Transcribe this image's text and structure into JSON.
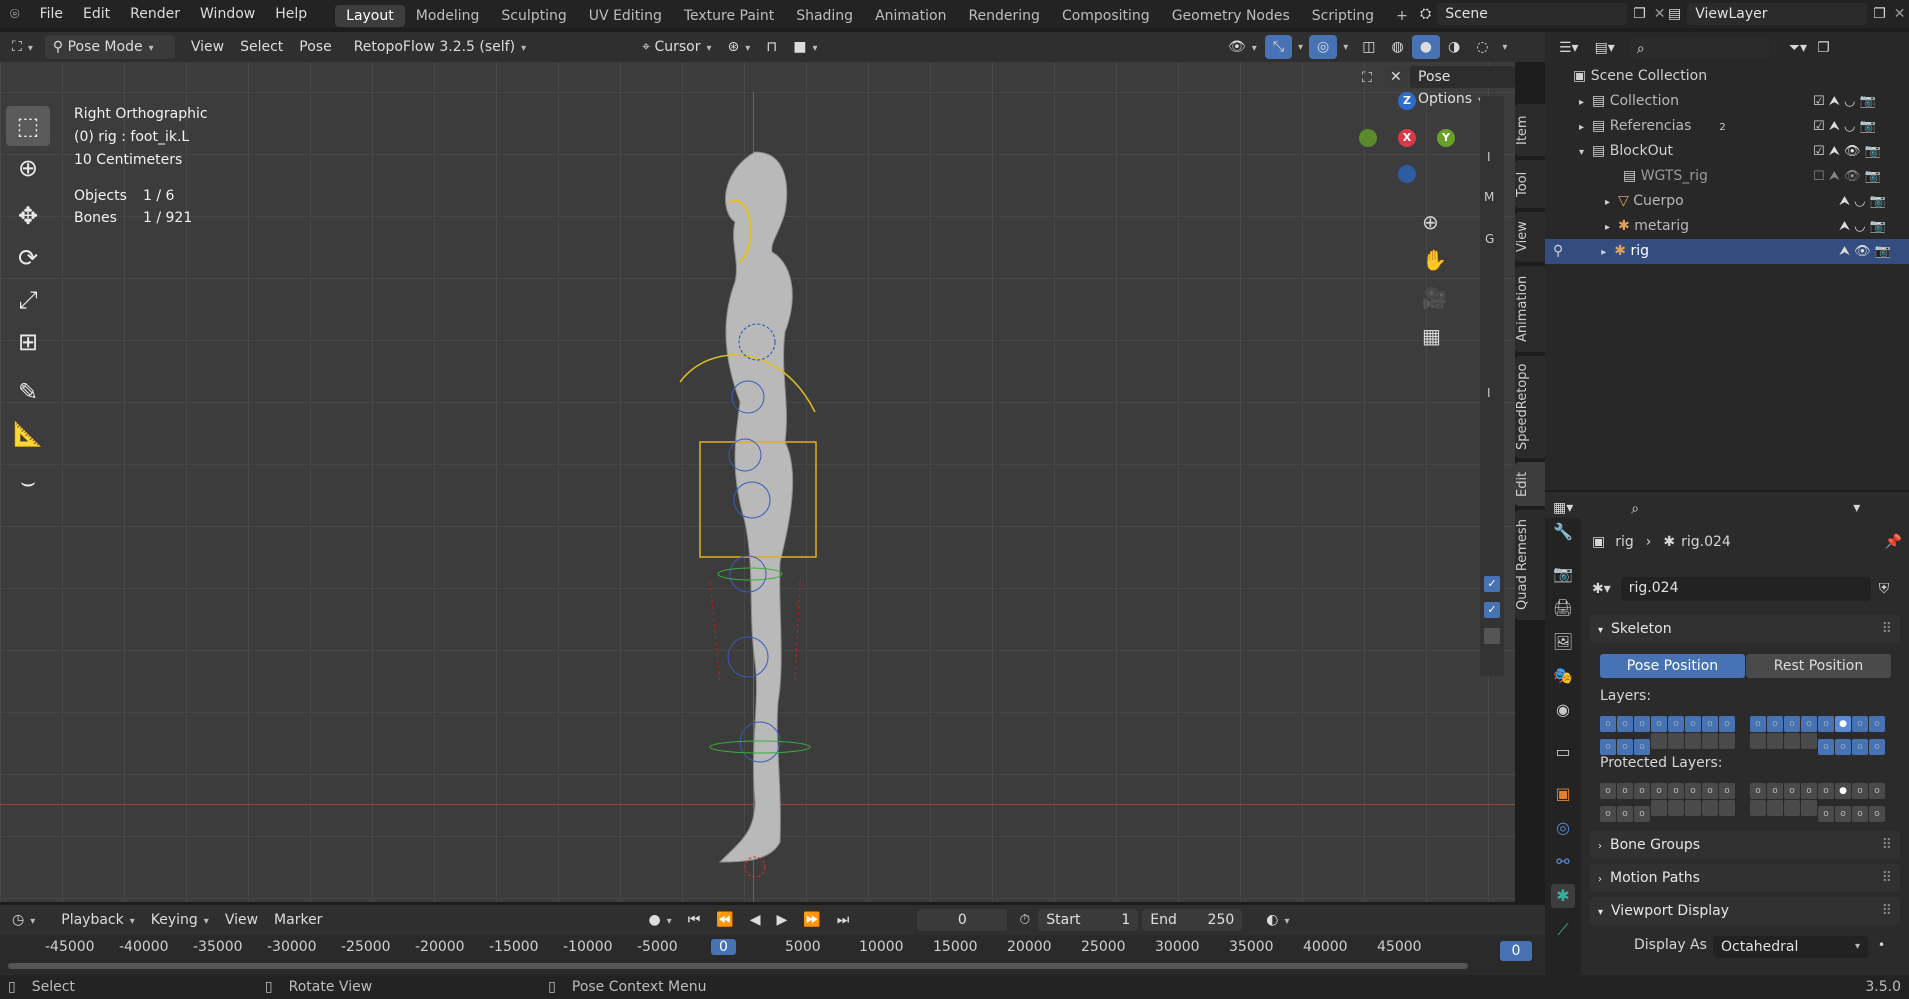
{
  "menu": {
    "items": [
      "File",
      "Edit",
      "Render",
      "Window",
      "Help"
    ]
  },
  "workspaces": {
    "tabs": [
      "Layout",
      "Modeling",
      "Sculpting",
      "UV Editing",
      "Texture Paint",
      "Shading",
      "Animation",
      "Rendering",
      "Compositing",
      "Geometry Nodes",
      "Scripting"
    ],
    "active": "Layout",
    "add": "+"
  },
  "scene": {
    "name": "Scene",
    "view_layer": "ViewLayer"
  },
  "header": {
    "mode": "Pose Mode",
    "view": "View",
    "select": "Select",
    "pose": "Pose",
    "addon": "RetopoFlow 3.2.5 (self)",
    "pivot": "Cursor",
    "pose_options": "Pose Options"
  },
  "viewport": {
    "view_name": "Right Orthographic",
    "object": "(0) rig : foot_ik.L",
    "scale": "10 Centimeters",
    "objects_label": "Objects",
    "objects_value": "1 / 6",
    "bones_label": "Bones",
    "bones_value": "1 / 921",
    "gizmo": {
      "z": "Z",
      "y": "Y",
      "x": "X"
    },
    "strip_letters": [
      "I",
      "M",
      "G",
      "I"
    ]
  },
  "sidetabs": [
    "Item",
    "Tool",
    "View",
    "Animation",
    "SpeedRetopo",
    "Edit",
    "Quad Remesh"
  ],
  "outliner": {
    "root": "Scene Collection",
    "rows": [
      {
        "label": "Collection",
        "indent": 1
      },
      {
        "label": "Referencias",
        "indent": 1,
        "badge": "2"
      },
      {
        "label": "BlockOut",
        "indent": 1
      },
      {
        "label": "WGTS_rig",
        "indent": 2
      },
      {
        "label": "Cuerpo",
        "indent": 2
      },
      {
        "label": "metarig",
        "indent": 2
      },
      {
        "label": "rig",
        "indent": 2
      }
    ]
  },
  "properties": {
    "breadcrumb_obj": "rig",
    "breadcrumb_data": "rig.024",
    "data_name": "rig.024",
    "skeleton": "Skeleton",
    "pose_position": "Pose Position",
    "rest_position": "Rest Position",
    "layers": "Layers:",
    "protected_layers": "Protected Layers:",
    "bone_groups": "Bone Groups",
    "motion_paths": "Motion Paths",
    "viewport_display": "Viewport Display",
    "display_as_label": "Display As",
    "display_as_value": "Octahedral"
  },
  "timeline": {
    "playback": "Playback",
    "keying": "Keying",
    "view": "View",
    "marker": "Marker",
    "current_frame": "0",
    "start_label": "Start",
    "start": "1",
    "end_label": "End",
    "end": "250",
    "ticks": [
      "-45000",
      "-40000",
      "-35000",
      "-30000",
      "-25000",
      "-20000",
      "-15000",
      "-10000",
      "-5000",
      "0",
      "5000",
      "10000",
      "15000",
      "20000",
      "25000",
      "30000",
      "35000",
      "40000",
      "45000"
    ],
    "frame_marker": "0"
  },
  "status": {
    "select": "Select",
    "rotate": "Rotate View",
    "context": "Pose Context Menu",
    "version": "3.5.0"
  }
}
